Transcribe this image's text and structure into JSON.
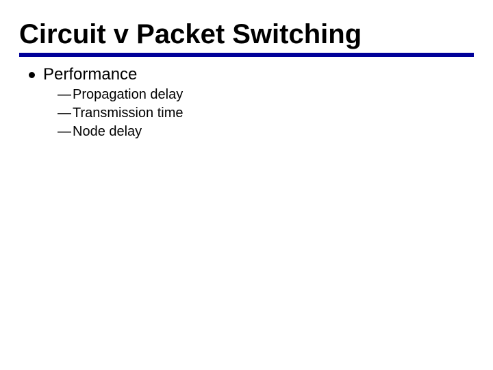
{
  "slide": {
    "title": "Circuit v Packet Switching",
    "bullets": [
      {
        "text": "Performance",
        "sub": [
          "Propagation delay",
          "Transmission time",
          "Node delay"
        ]
      }
    ]
  }
}
